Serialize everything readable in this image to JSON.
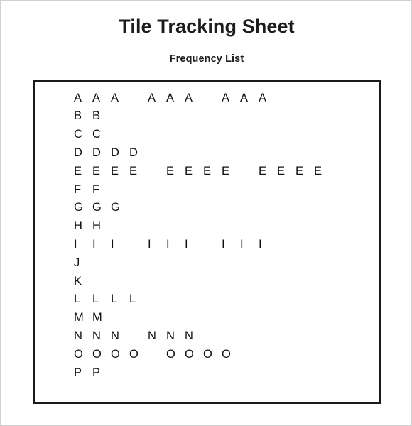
{
  "document": {
    "title": "Tile Tracking Sheet",
    "subtitle": "Frequency List"
  },
  "frequency_box": {
    "border_color": "#1a1a1a",
    "rows": [
      {
        "letter": "A",
        "total": 9,
        "groups": [
          3,
          3,
          3
        ]
      },
      {
        "letter": "B",
        "total": 2,
        "groups": [
          2
        ]
      },
      {
        "letter": "C",
        "total": 2,
        "groups": [
          2
        ]
      },
      {
        "letter": "D",
        "total": 4,
        "groups": [
          4
        ]
      },
      {
        "letter": "E",
        "total": 12,
        "groups": [
          4,
          4,
          4
        ]
      },
      {
        "letter": "F",
        "total": 2,
        "groups": [
          2
        ]
      },
      {
        "letter": "G",
        "total": 3,
        "groups": [
          3
        ]
      },
      {
        "letter": "H",
        "total": 2,
        "groups": [
          2
        ]
      },
      {
        "letter": "I",
        "total": 9,
        "groups": [
          3,
          3,
          3
        ]
      },
      {
        "letter": "J",
        "total": 1,
        "groups": [
          1
        ]
      },
      {
        "letter": "K",
        "total": 1,
        "groups": [
          1
        ]
      },
      {
        "letter": "L",
        "total": 4,
        "groups": [
          4
        ]
      },
      {
        "letter": "M",
        "total": 2,
        "groups": [
          2
        ]
      },
      {
        "letter": "N",
        "total": 6,
        "groups": [
          3,
          3
        ]
      },
      {
        "letter": "O",
        "total": 8,
        "groups": [
          4,
          4
        ]
      },
      {
        "letter": "P",
        "total": 2,
        "groups": [
          2
        ]
      }
    ]
  }
}
